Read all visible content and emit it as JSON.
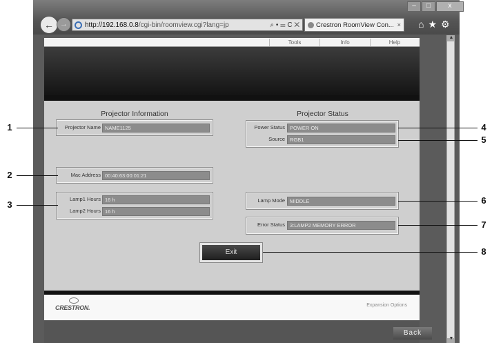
{
  "browser": {
    "url_host": "http://192.168.0.8",
    "url_path": "/cgi-bin/roomview.cgi?lang=jp",
    "address_controls": "⌕ • ☰ C ✕",
    "tab_title": "Crestron RoomView Con...",
    "tab_close": "×",
    "toolbar_icons": "⌂★⚙",
    "window_buttons": {
      "minimize": "–",
      "maximize": "□",
      "close": "x"
    }
  },
  "menu": {
    "tools": "Tools",
    "info": "Info",
    "help": "Help"
  },
  "projector_information": {
    "heading": "Projector Information",
    "projector_name_label": "Projector Name",
    "projector_name": "NAME1125",
    "mac_address_label": "Mac Address",
    "mac_address": "00:40:63:00:01:21",
    "lamp1_hours_label": "Lamp1 Hours",
    "lamp1_hours": "16 h",
    "lamp2_hours_label": "Lamp2 Hours",
    "lamp2_hours": "16 h"
  },
  "projector_status": {
    "heading": "Projector Status",
    "power_status_label": "Power Status",
    "power_status": "POWER ON",
    "source_label": "Source",
    "source": "RGB1",
    "lamp_mode_label": "Lamp Mode",
    "lamp_mode": "MIDDLE",
    "error_status_label": "Error Status",
    "error_status": "3:LAMP2 MEMORY ERROR"
  },
  "exit_label": "Exit",
  "footer": {
    "logo_text": "CRESTRON.",
    "expansion_options": "Expansion Options",
    "back_label": "Back"
  },
  "callouts": [
    "1",
    "2",
    "3",
    "4",
    "5",
    "6",
    "7",
    "8"
  ]
}
